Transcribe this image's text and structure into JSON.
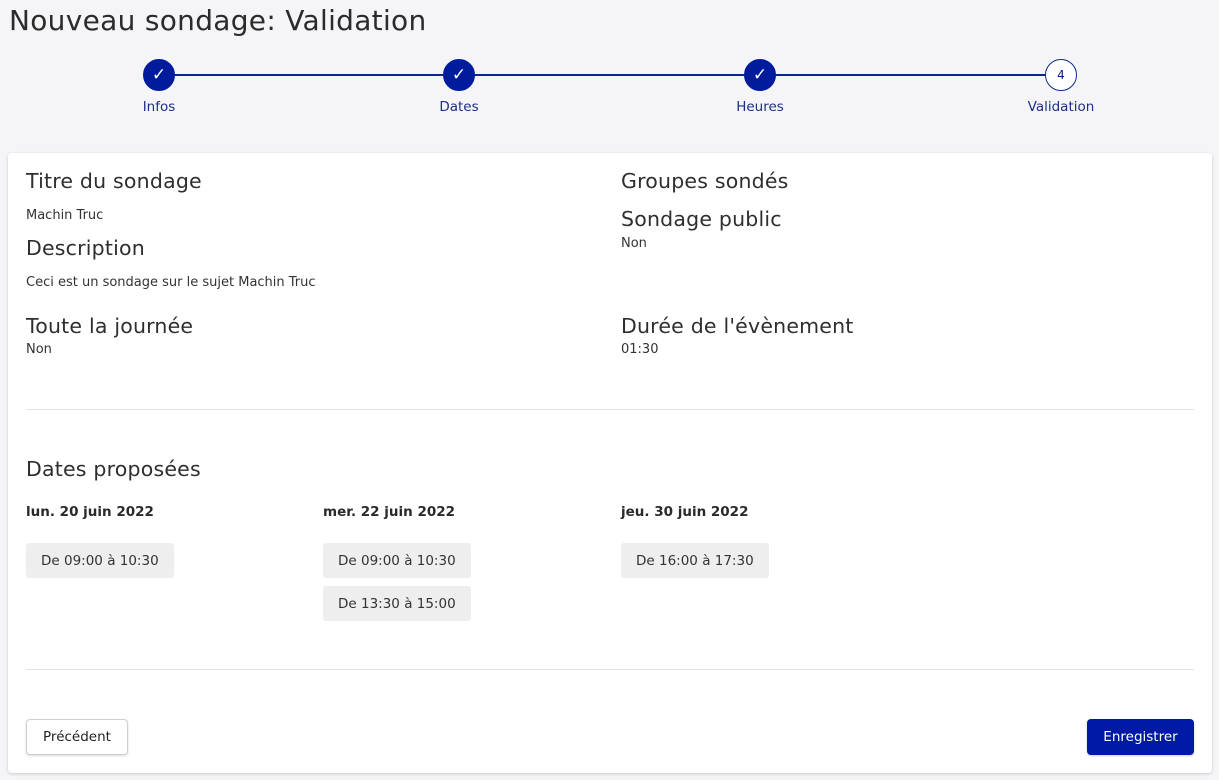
{
  "page": {
    "title": "Nouveau sondage: Validation"
  },
  "stepper": {
    "steps": [
      {
        "label": "Infos",
        "state": "done",
        "marker": "✓"
      },
      {
        "label": "Dates",
        "state": "done",
        "marker": "✓"
      },
      {
        "label": "Heures",
        "state": "done",
        "marker": "✓"
      },
      {
        "label": "Validation",
        "state": "current",
        "marker": "4"
      }
    ]
  },
  "summary": {
    "title_heading": "Titre du sondage",
    "title_value": "Machin Truc",
    "description_heading": "Description",
    "description_value": "Ceci est un sondage sur le sujet Machin Truc",
    "groups_heading": "Groupes sondés",
    "public_heading": "Sondage public",
    "public_value": "Non",
    "all_day_heading": "Toute la journée",
    "all_day_value": "Non",
    "duration_heading": "Durée de l'évènement",
    "duration_value": "01:30"
  },
  "dates": {
    "heading": "Dates proposées",
    "days": [
      {
        "date": "lun. 20 juin 2022",
        "slots": [
          "De 09:00 à 10:30"
        ]
      },
      {
        "date": "mer. 22 juin 2022",
        "slots": [
          "De 09:00 à 10:30",
          "De 13:30 à 15:00"
        ]
      },
      {
        "date": "jeu. 30 juin 2022",
        "slots": [
          "De 16:00 à 17:30"
        ]
      }
    ]
  },
  "actions": {
    "previous_label": "Précédent",
    "save_label": "Enregistrer"
  },
  "colors": {
    "accent": "#001c9c",
    "background": "#f5f5f8",
    "chip": "#eeeeee"
  }
}
